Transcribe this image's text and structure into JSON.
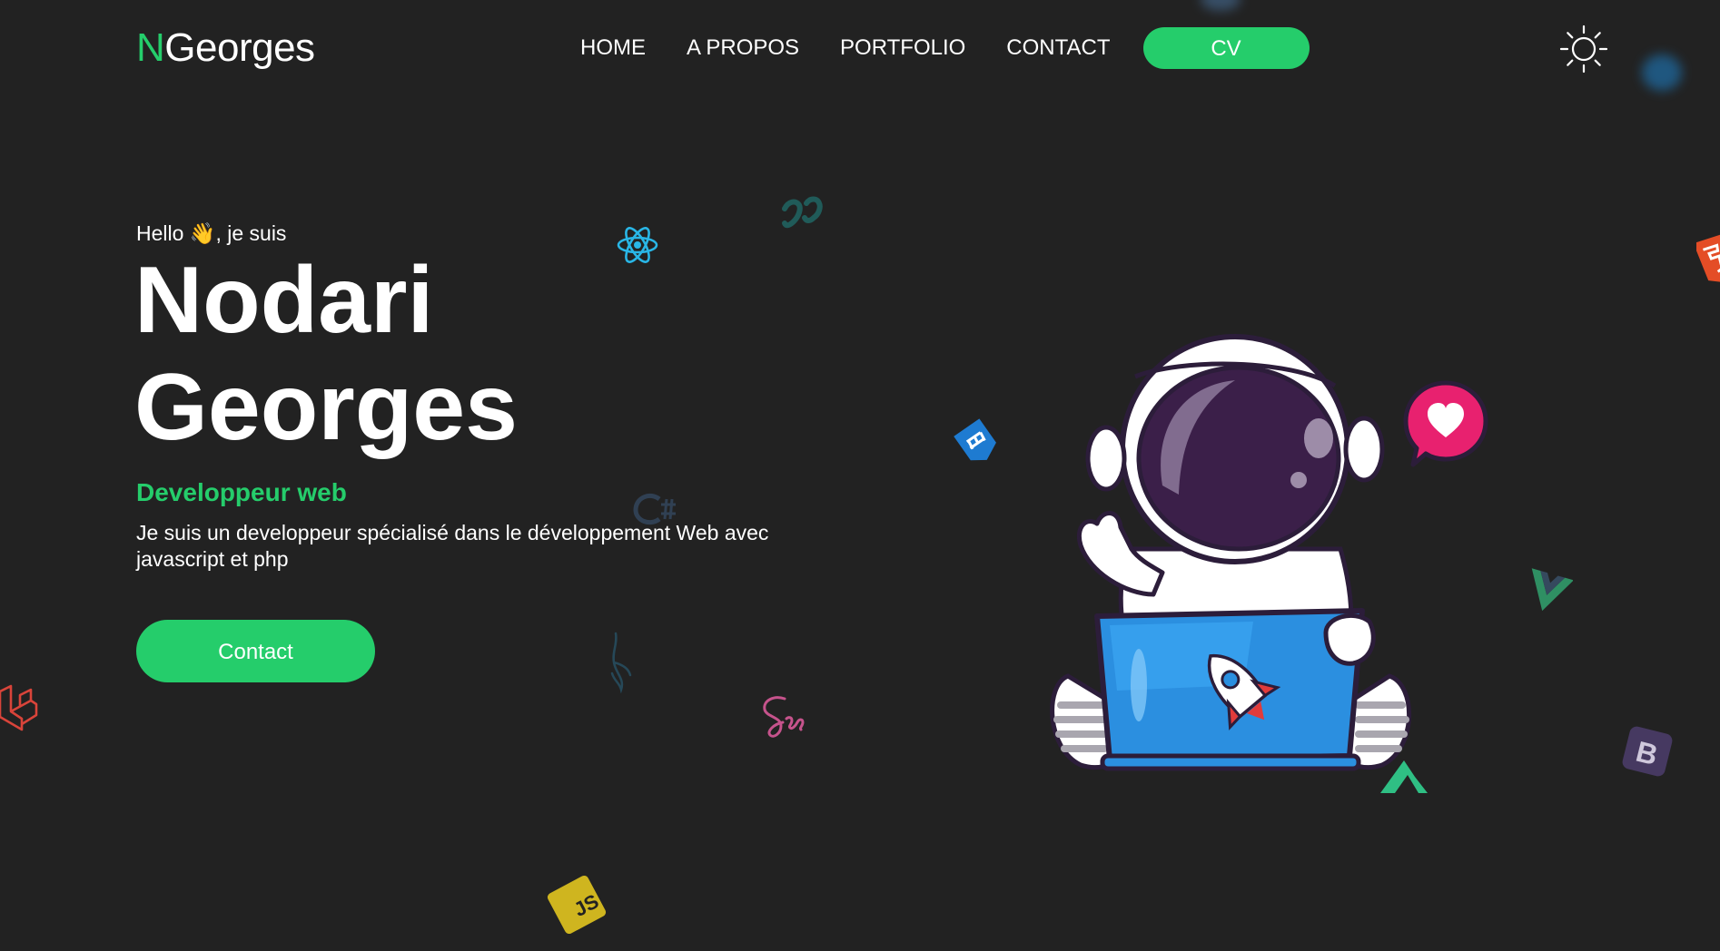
{
  "navbar": {
    "logo_initial": "N",
    "logo_rest": "Georges",
    "links": {
      "home": "HOME",
      "about": "A PROPOS",
      "portfolio": "PORTFOLIO",
      "contact": "CONTACT"
    },
    "cv_label": "CV",
    "theme_icon": "sun-icon"
  },
  "hero": {
    "greeting_before": "Hello ",
    "greeting_emoji": "👋",
    "greeting_after": ", je suis",
    "first_name": "Nodari",
    "last_name": "Georges",
    "role": "Developpeur web",
    "description": "Je suis un developpeur spécialisé dans le développement Web avec javascript et php",
    "contact_label": "Contact"
  },
  "colors": {
    "background": "#222222",
    "accent": "#25cd6b",
    "text": "#ffffff"
  },
  "floating_icons": [
    "react-icon",
    "tailwind-icon",
    "html5-icon",
    "mui-icon",
    "csharp-icon",
    "mysql-icon",
    "laravel-icon",
    "sass-icon",
    "vue-icon",
    "bootstrap-icon",
    "javascript-icon",
    "nuxt-icon",
    "heart-icon"
  ],
  "illustration": "astronaut-with-laptop-illustration"
}
